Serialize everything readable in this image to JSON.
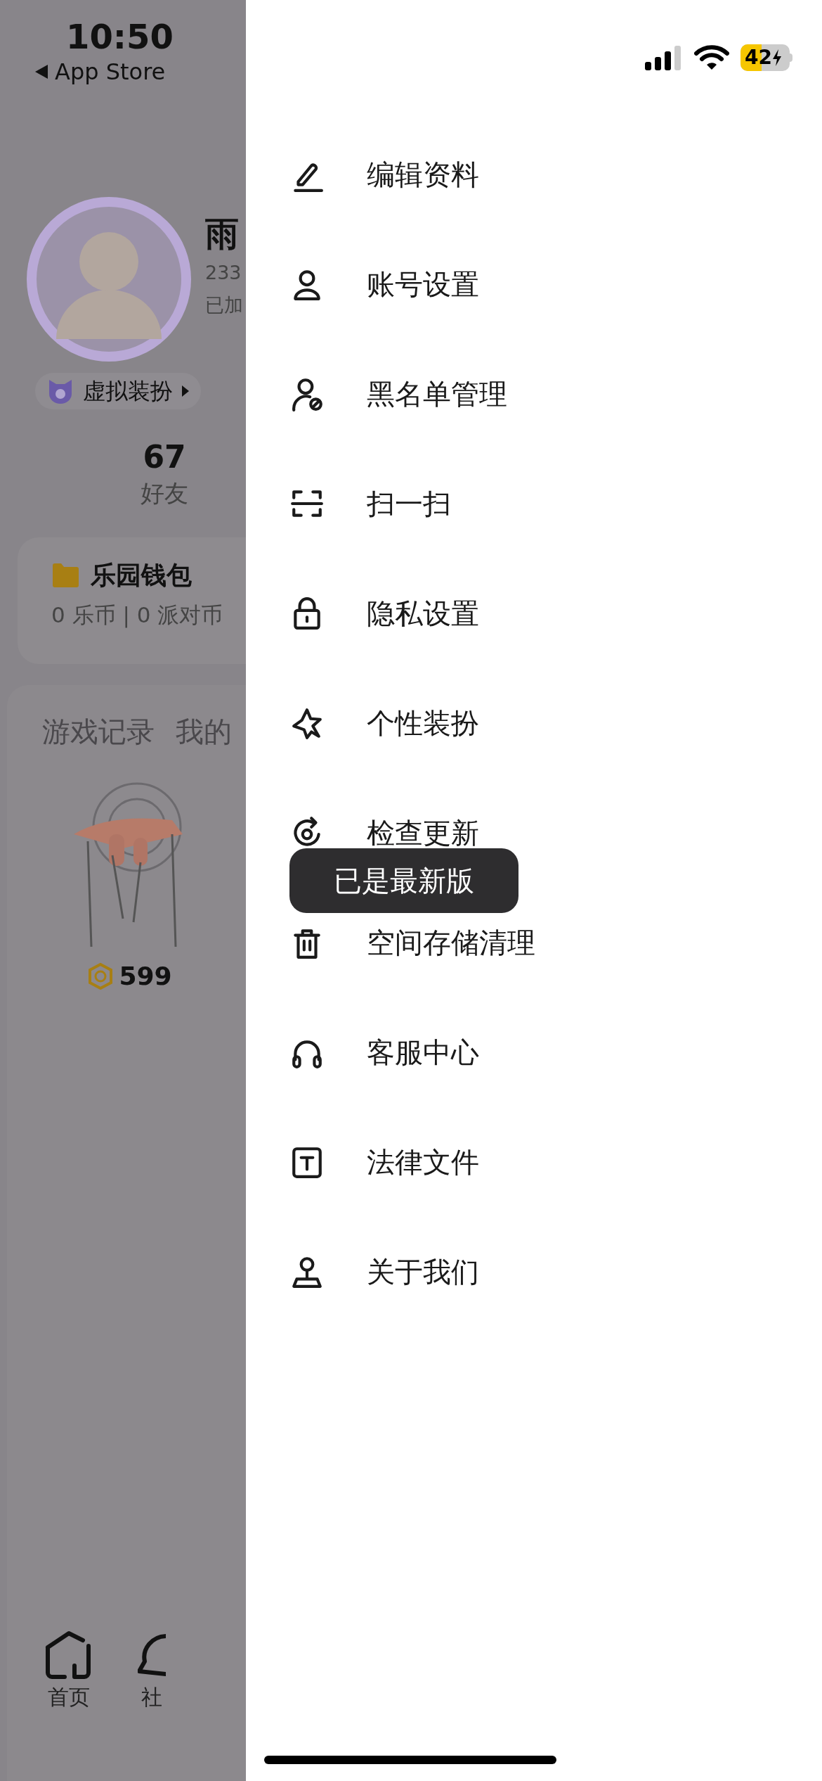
{
  "status_bar": {
    "time": "10:50",
    "back_label": "App Store",
    "battery": "42"
  },
  "profile": {
    "name": "雨",
    "id": "233",
    "joined": "已加",
    "decoration": "虚拟装扮"
  },
  "stats": [
    {
      "value": "67",
      "label": "好友"
    }
  ],
  "wallet": {
    "title": "乐园钱包",
    "balance": "0 乐币 | 0 派对币"
  },
  "section_tabs": [
    "游戏记录",
    "我的"
  ],
  "games": [
    {
      "kind": "picture",
      "price": "599"
    }
  ],
  "bottom_nav": [
    {
      "label": "首页"
    },
    {
      "label": "社"
    }
  ],
  "drawer": {
    "items": [
      {
        "label": "编辑资料"
      },
      {
        "label": "账号设置"
      },
      {
        "label": "黑名单管理"
      },
      {
        "label": "扫一扫"
      },
      {
        "label": "隐私设置"
      },
      {
        "label": "个性装扮"
      },
      {
        "label": "检查更新"
      },
      {
        "label": "空间存储清理"
      },
      {
        "label": "客服中心"
      },
      {
        "label": "法律文件"
      },
      {
        "label": "关于我们"
      }
    ],
    "toast": "已是最新版"
  }
}
